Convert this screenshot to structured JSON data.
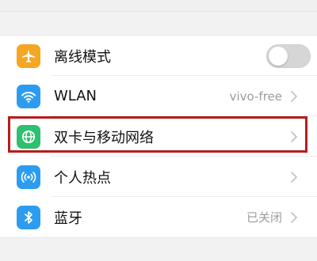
{
  "settings": {
    "items": [
      {
        "label": "离线模式",
        "icon": "airplane-icon",
        "color": "#f5a623",
        "control": "toggle",
        "toggle_on": false
      },
      {
        "label": "WLAN",
        "value": "vivo-free",
        "icon": "wifi-icon",
        "color": "#2d9cf0"
      },
      {
        "label": "双卡与移动网络",
        "icon": "globe-icon",
        "color": "#2fbf71"
      },
      {
        "label": "个人热点",
        "icon": "hotspot-icon",
        "color": "#2d9cf0"
      },
      {
        "label": "蓝牙",
        "value": "已关闭",
        "icon": "bluetooth-icon",
        "color": "#2d9cf0"
      }
    ]
  },
  "highlight_color": "#b81b1b"
}
